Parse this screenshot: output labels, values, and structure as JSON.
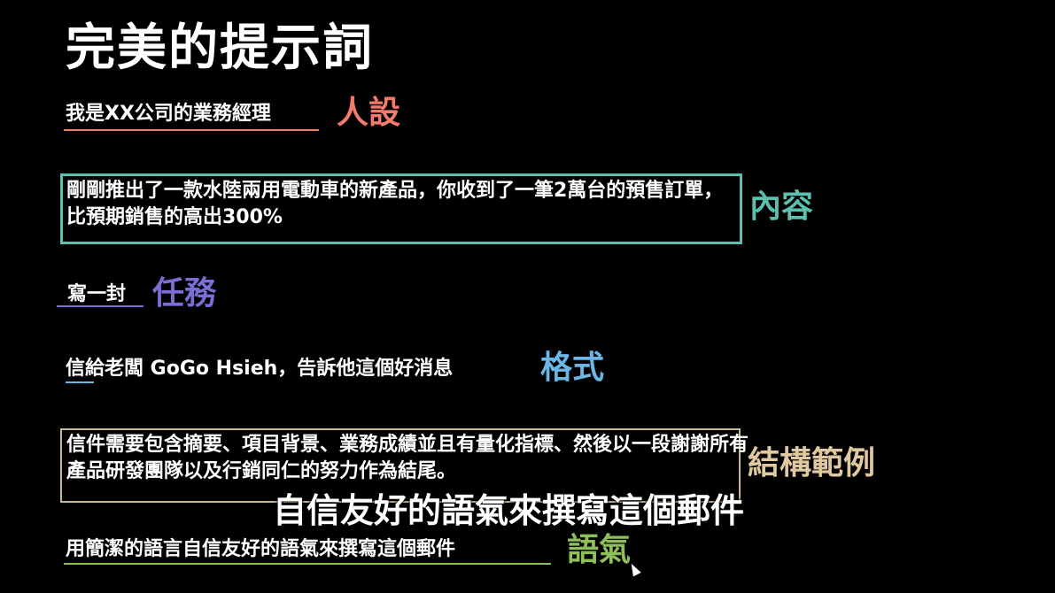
{
  "slide": {
    "title": "完美的提示詞",
    "subtitle": "自信友好的語氣來撰寫這個郵件"
  },
  "sections": {
    "persona": {
      "text": "我是XX公司的業務經理",
      "tag": "人設",
      "color": "#f47a6e"
    },
    "content": {
      "text": "剛剛推出了一款水陸兩用電動車的新產品，你收到了一筆2萬台的預售訂單，比預期銷售的高出300%",
      "tag": "內容",
      "color": "#5bc0ad"
    },
    "task": {
      "text": "寫一封",
      "tag": "任務",
      "color": "#7b6fd6"
    },
    "format": {
      "text": "信給老闆 GoGo Hsieh，告訴他這個好消息",
      "tag": "格式",
      "color": "#6ab7e6"
    },
    "structure": {
      "text": "信件需要包含摘要、項目背景、業務成績並且有量化指標、然後以一段謝謝所有產品研發團隊以及行銷同仁的努力作為結尾。",
      "tag": "結構範例",
      "color": "#e0c9a0"
    },
    "tone": {
      "text": "用簡潔的語言自信友好的語氣來撰寫這個郵件",
      "tag": "語氣",
      "color": "#8fbf5a"
    }
  }
}
